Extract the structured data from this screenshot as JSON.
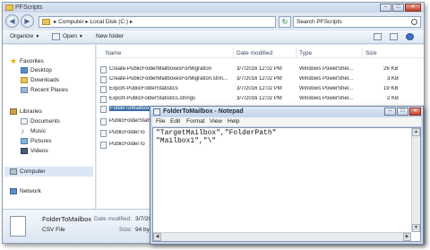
{
  "window": {
    "title": "PFScripts"
  },
  "address": {
    "crumbs": "▸ Computer ▸ Local Disk (C:) ▸"
  },
  "search": {
    "placeholder": "Search PFScripts"
  },
  "toolbar": {
    "organize": "Organize",
    "open": "Open",
    "new_folder": "New folder"
  },
  "sidebar": {
    "favorites": "Favorites",
    "desktop": "Desktop",
    "downloads": "Downloads",
    "recent": "Recent Places",
    "libraries": "Libraries",
    "documents": "Documents",
    "music": "Music",
    "pictures": "Pictures",
    "videos": "Videos",
    "computer": "Computer",
    "network": "Network"
  },
  "columns": {
    "name": "Name",
    "date": "Date modified",
    "type": "Type",
    "size": "Size"
  },
  "files": [
    {
      "name": "Create-PublicFolderMailboxesForMigration",
      "date": "3/7/2016 12:02 PM",
      "type": "Windows PowerShel...",
      "size": "26 KB"
    },
    {
      "name": "Create-PublicFolderMailboxesForMigration.strin...",
      "date": "3/7/2016 12:02 PM",
      "type": "Windows PowerShel...",
      "size": "3 KB"
    },
    {
      "name": "Export-PublicFolderStatistics",
      "date": "3/7/2016 12:02 PM",
      "type": "Windows PowerShel...",
      "size": "19 KB"
    },
    {
      "name": "Export-PublicFolderStatistics.strings",
      "date": "3/7/2016 12:02 PM",
      "type": "Windows PowerShel...",
      "size": "2 KB"
    },
    {
      "name": "FolderToMailbox",
      "date": "",
      "type": "",
      "size": ""
    },
    {
      "name": "PublicFolderStats",
      "date": "",
      "type": "",
      "size": ""
    },
    {
      "name": "PublicFolderTo",
      "date": "",
      "type": "",
      "size": ""
    },
    {
      "name": "PublicFolderTo",
      "date": "",
      "type": "",
      "size": ""
    }
  ],
  "details": {
    "name": "FolderToMailbox",
    "type": "CSV File",
    "date_label": "Date modified:",
    "date_value": "3/7/201",
    "size_label": "Size:",
    "size_value": "94 byte"
  },
  "notepad": {
    "title": "FolderToMailbox - Notepad",
    "menu": [
      "File",
      "Edit",
      "Format",
      "View",
      "Help"
    ],
    "lines": [
      "\"TargetMailbox\",\"FolderPath\"",
      "\"Mailbox1\",\"\\\""
    ]
  }
}
